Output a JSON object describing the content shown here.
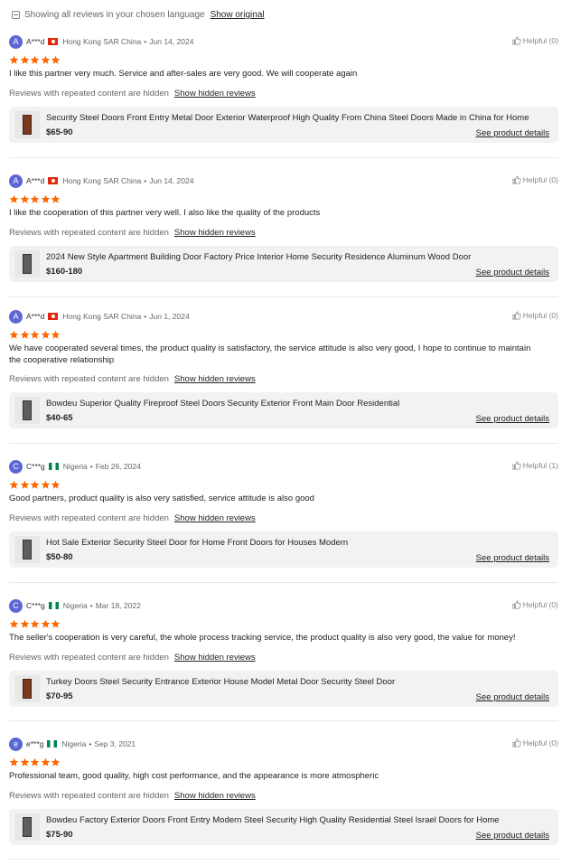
{
  "language_bar": {
    "text": "Showing all reviews in your chosen language",
    "link": "Show original"
  },
  "colors": {
    "accent_star": "#ff6600",
    "avatar_bg": "#5b67d4"
  },
  "reviews": [
    {
      "avatar_letter": "A",
      "user": "A***d",
      "flag": "hk",
      "country": "Hong Kong SAR China",
      "date": "Jun 14, 2024",
      "helpful": "Helpful (0)",
      "rating": 5,
      "comment": "I like this partner very much. Service and after-sales are very good. We will cooperate again",
      "hidden_text": "Reviews with repeated content are hidden",
      "hidden_link": "Show hidden reviews",
      "product": {
        "title": "Security Steel Doors Front Entry Metal Door Exterior Waterproof High Quality From China Steel Doors Made in China for Home",
        "price": "$65-90",
        "details": "See product details",
        "image": "brown-door"
      }
    },
    {
      "avatar_letter": "A",
      "user": "A***d",
      "flag": "hk",
      "country": "Hong Kong SAR China",
      "date": "Jun 14, 2024",
      "helpful": "Helpful (0)",
      "rating": 5,
      "comment": "I like the cooperation of this partner very well. I also like the quality of the products",
      "hidden_text": "Reviews with repeated content are hidden",
      "hidden_link": "Show hidden reviews",
      "product": {
        "title": "2024 New Style Apartment Building Door Factory Price Interior Home Security Residence Aluminum Wood Door",
        "price": "$160-180",
        "details": "See product details",
        "image": "gray-door"
      }
    },
    {
      "avatar_letter": "A",
      "user": "A***d",
      "flag": "hk",
      "country": "Hong Kong SAR China",
      "date": "Jun 1, 2024",
      "helpful": "Helpful (0)",
      "rating": 5,
      "comment": "We have cooperated several times, the product quality is satisfactory, the service attitude is also very good, I hope to continue to maintain the cooperative relationship",
      "hidden_text": "Reviews with repeated content are hidden",
      "hidden_link": "Show hidden reviews",
      "product": {
        "title": "Bowdeu Superior Quality Fireproof Steel Doors Security Exterior Front Main Door Residential",
        "price": "$40-65",
        "details": "See product details",
        "image": "gray-door"
      }
    },
    {
      "avatar_letter": "C",
      "user": "C***g",
      "flag": "ng",
      "country": "Nigeria",
      "date": "Feb 26, 2024",
      "helpful": "Helpful (1)",
      "rating": 5,
      "comment": "Good partners, product quality is also very satisfied, service attitude is also good",
      "hidden_text": "Reviews with repeated content are hidden",
      "hidden_link": "Show hidden reviews",
      "product": {
        "title": "Hot Sale Exterior Security Steel Door for Home Front Doors for Houses Modern",
        "price": "$50-80",
        "details": "See product details",
        "image": "gray-door"
      }
    },
    {
      "avatar_letter": "C",
      "user": "C***g",
      "flag": "ng",
      "country": "Nigeria",
      "date": "Mar 18, 2022",
      "helpful": "Helpful (0)",
      "rating": 5,
      "comment": "The seller's cooperation is very careful, the whole process tracking service, the product quality is also very good, the value for money!",
      "hidden_text": "Reviews with repeated content are hidden",
      "hidden_link": "Show hidden reviews",
      "product": {
        "title": "Turkey Doors Steel Security Entrance Exterior House Model Metal Door Security Steel Door",
        "price": "$70-95",
        "details": "See product details",
        "image": "brown-door"
      }
    },
    {
      "avatar_letter": "e",
      "user": "e***g",
      "flag": "ng",
      "country": "Nigeria",
      "date": "Sep 3, 2021",
      "helpful": "Helpful (0)",
      "rating": 5,
      "comment": "Professional team, good quality, high cost performance, and the appearance is more atmospheric",
      "hidden_text": "Reviews with repeated content are hidden",
      "hidden_link": "Show hidden reviews",
      "product": {
        "title": "Bowdeu Factory Exterior Doors Front Entry Modern Steel Security High Quality Residential Steel Israel Doors for Home",
        "price": "$75-90",
        "details": "See product details",
        "image": "gray-door"
      }
    }
  ]
}
